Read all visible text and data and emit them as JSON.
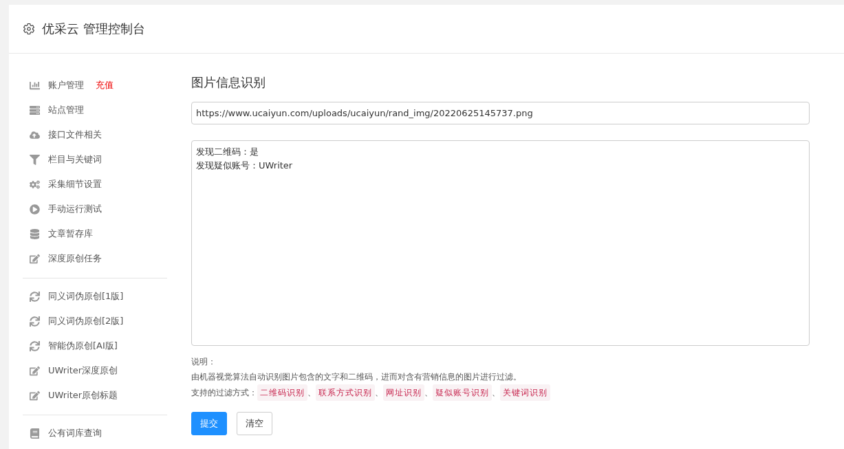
{
  "header": {
    "title": "优采云 管理控制台"
  },
  "sidebar": {
    "groups": [
      [
        {
          "label": "账户管理",
          "badge": "充值",
          "kind": "chart"
        },
        {
          "label": "站点管理",
          "kind": "server"
        },
        {
          "label": "接口文件相关",
          "kind": "cloud"
        },
        {
          "label": "栏目与关键词",
          "kind": "filter"
        },
        {
          "label": "采集细节设置",
          "kind": "cogs"
        },
        {
          "label": "手动运行测试",
          "kind": "play"
        },
        {
          "label": "文章暂存库",
          "kind": "database"
        },
        {
          "label": "深度原创任务",
          "kind": "edit"
        }
      ],
      [
        {
          "label": "同义词伪原创[1版]",
          "kind": "sync"
        },
        {
          "label": "同义词伪原创[2版]",
          "kind": "sync"
        },
        {
          "label": "智能伪原创[AI版]",
          "kind": "sync"
        },
        {
          "label": "UWriter深度原创",
          "kind": "edit"
        },
        {
          "label": "UWriter原创标题",
          "kind": "edit"
        }
      ],
      [
        {
          "label": "公有词库查询",
          "kind": "book"
        }
      ]
    ]
  },
  "main": {
    "title": "图片信息识别",
    "url_field": {
      "value": "https://www.ucaiyun.com/uploads/ucaiyun/rand_img/20220625145737.png"
    },
    "result_box": {
      "lines": [
        "发现二维码：是",
        "发现疑似账号：UWriter"
      ]
    },
    "note_label": "说明：",
    "note_text": "由机器视觉算法自动识别图片包含的文字和二维码，进而对含有营销信息的图片进行过滤。",
    "methods_label": "支持的过滤方式：",
    "methods": [
      "二维码识别",
      "联系方式识别",
      "网址识别",
      "疑似账号识别",
      "关键词识别"
    ],
    "separator": "、",
    "buttons": [
      {
        "label": "提交",
        "kind": "primary"
      },
      {
        "label": "清空",
        "kind": "default"
      }
    ]
  }
}
